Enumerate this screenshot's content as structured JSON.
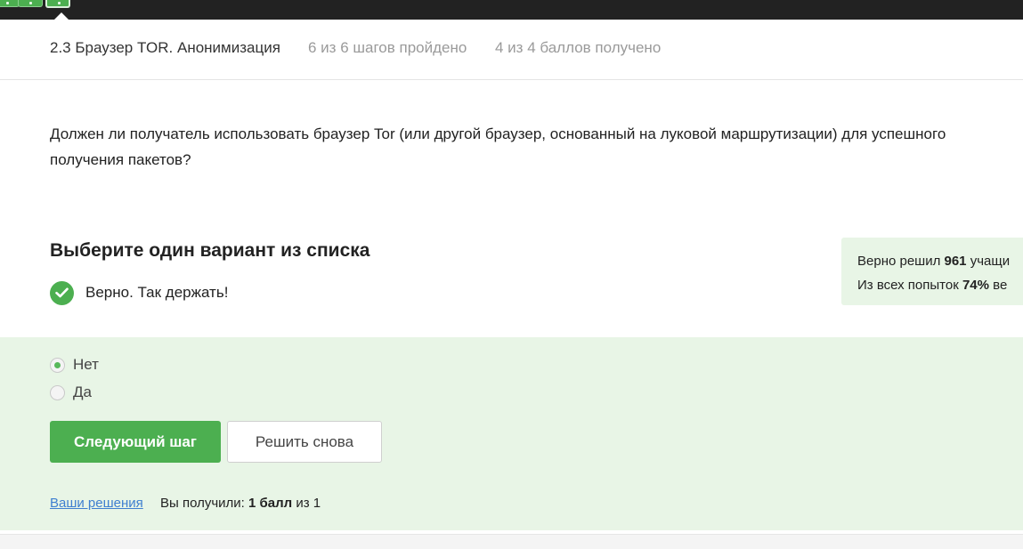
{
  "header": {
    "lesson_title": "2.3 Браузер TOR. Анонимизация",
    "steps_progress": "6 из 6 шагов пройдено",
    "points_progress": "4 из 4 баллов  получено"
  },
  "question": {
    "text": "Должен ли получатель использовать браузер Tor (или другой браузер, основанный на луковой маршрутизации) для успешного получения пакетов?"
  },
  "quiz": {
    "title": "Выберите один вариант из списка",
    "feedback": "Верно. Так держать!",
    "options": [
      {
        "label": "Нет",
        "selected": true
      },
      {
        "label": "Да",
        "selected": false
      }
    ],
    "next_button": "Следующий шаг",
    "retry_button": "Решить снова"
  },
  "stats": {
    "line1_prefix": "Верно решил ",
    "line1_count": "961",
    "line1_suffix": " учащи",
    "line2_prefix": "Из всех попыток ",
    "line2_percent": "74%",
    "line2_suffix": " ве"
  },
  "footer": {
    "solutions_link": "Ваши решения",
    "score_prefix": "Вы получили: ",
    "score_value": "1 балл",
    "score_suffix": " из 1"
  },
  "colors": {
    "accent": "#4caf50",
    "correct_bg": "#e8f5e6",
    "topbar": "#222222",
    "link": "#3f7fd0"
  }
}
